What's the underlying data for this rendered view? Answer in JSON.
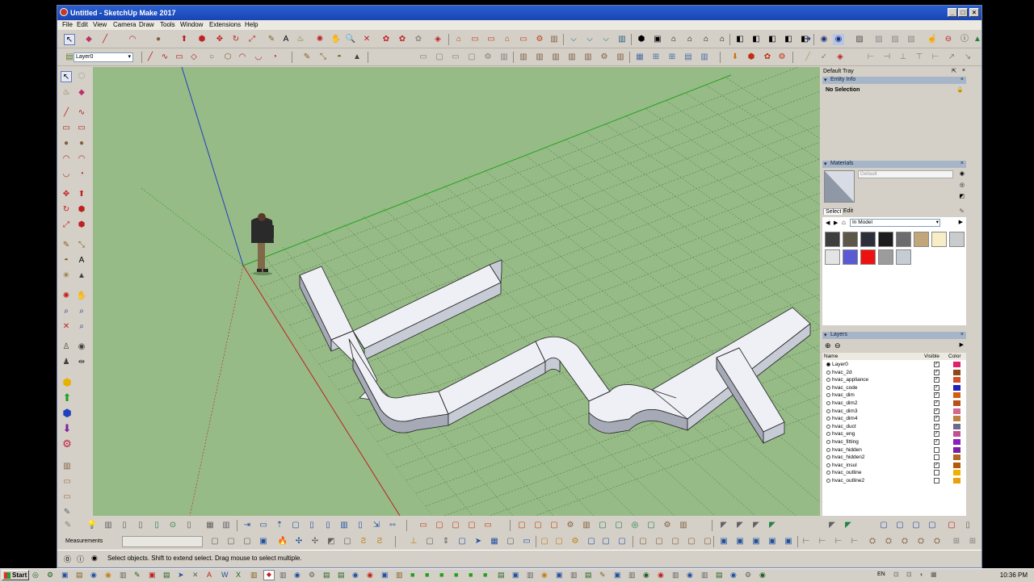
{
  "window": {
    "title": "Untitled - SketchUp Make 2017"
  },
  "menu": [
    "File",
    "Edit",
    "View",
    "Camera",
    "Draw",
    "Tools",
    "Window",
    "Extensions",
    "Help"
  ],
  "layer_dropdown": {
    "value": "Layer0"
  },
  "tray": {
    "title": "Default Tray",
    "entity_info": {
      "title": "Entity Info",
      "selection": "No Selection"
    },
    "materials": {
      "title": "Materials",
      "name_value": "Default",
      "tabs": [
        "Select",
        "Edit"
      ],
      "collection": "In Model",
      "swatches": [
        "#3e3e3e",
        "#5c5748",
        "#2c2e3a",
        "#1c1c1c",
        "#6c6c6c",
        "#c1a67a",
        "#f7eec8",
        "#c9cbcd",
        "#e4e4e4",
        "#5a5ad4",
        "#ee1111",
        "#9c9c9c",
        "#c6ccd4"
      ]
    },
    "layers": {
      "title": "Layers",
      "col_name": "Name",
      "col_visible": "Visible",
      "col_color": "Color",
      "items": [
        {
          "name": "Layer0",
          "active": true,
          "visible": true,
          "color": "#e0206a"
        },
        {
          "name": "hvac_2d",
          "active": false,
          "visible": true,
          "color": "#8a4a1a"
        },
        {
          "name": "hvac_appliance",
          "active": false,
          "visible": true,
          "color": "#d4502a"
        },
        {
          "name": "hvac_code",
          "active": false,
          "visible": true,
          "color": "#2020c0"
        },
        {
          "name": "hvac_dim",
          "active": false,
          "visible": true,
          "color": "#d06010"
        },
        {
          "name": "hvac_dim2",
          "active": false,
          "visible": true,
          "color": "#b85020"
        },
        {
          "name": "hvac_dim3",
          "active": false,
          "visible": true,
          "color": "#d06a90"
        },
        {
          "name": "hvac_dim4",
          "active": false,
          "visible": true,
          "color": "#c08040"
        },
        {
          "name": "hvac_duct",
          "active": false,
          "visible": true,
          "color": "#6a6a8a"
        },
        {
          "name": "hvac_eng",
          "active": false,
          "visible": true,
          "color": "#c05090"
        },
        {
          "name": "hvac_fitting",
          "active": false,
          "visible": true,
          "color": "#8a20c0"
        },
        {
          "name": "hvac_hidden",
          "active": false,
          "visible": false,
          "color": "#7a20a0"
        },
        {
          "name": "hvac_hidden2",
          "active": false,
          "visible": false,
          "color": "#b06a20"
        },
        {
          "name": "hvac_insul",
          "active": false,
          "visible": true,
          "color": "#b05a10"
        },
        {
          "name": "hvac_outline",
          "active": false,
          "visible": false,
          "color": "#f0b000"
        },
        {
          "name": "hvac_outline2",
          "active": false,
          "visible": false,
          "color": "#e8a010"
        }
      ]
    }
  },
  "measurements_label": "Measurements",
  "status_text": "Select objects. Shift to extend select. Drag mouse to select multiple.",
  "taskbar": {
    "start": "Start",
    "lang": "EN",
    "clock": "10:36 PM"
  }
}
